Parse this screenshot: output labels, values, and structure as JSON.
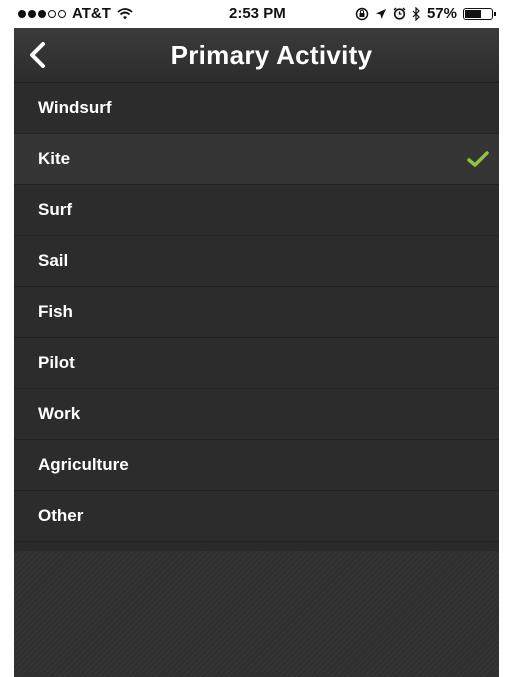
{
  "status_bar": {
    "carrier": "AT&T",
    "time": "2:53 PM",
    "battery": "57%",
    "signal_bars_filled": 3,
    "signal_bars_total": 5
  },
  "nav": {
    "title": "Primary Activity",
    "back_icon": "chevron-left-icon"
  },
  "activities": [
    {
      "label": "Windsurf",
      "selected": false
    },
    {
      "label": "Kite",
      "selected": true
    },
    {
      "label": "Surf",
      "selected": false
    },
    {
      "label": "Sail",
      "selected": false
    },
    {
      "label": "Fish",
      "selected": false
    },
    {
      "label": "Pilot",
      "selected": false
    },
    {
      "label": "Work",
      "selected": false
    },
    {
      "label": "Agriculture",
      "selected": false
    },
    {
      "label": "Other",
      "selected": false
    }
  ],
  "colors": {
    "check": "#8cc63f",
    "background": "#2c2c2c",
    "selected_row": "#353535"
  }
}
